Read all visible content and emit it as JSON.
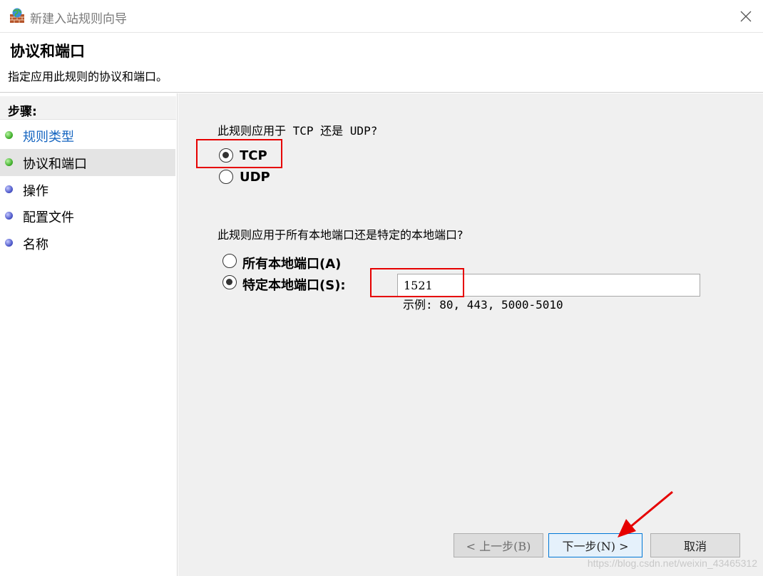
{
  "window": {
    "title": "新建入站规则向导"
  },
  "header": {
    "title": "协议和端口",
    "subtitle": "指定应用此规则的协议和端口。"
  },
  "sidebar": {
    "title": "步骤:",
    "items": [
      {
        "label": "规则类型"
      },
      {
        "label": "协议和端口"
      },
      {
        "label": "操作"
      },
      {
        "label": "配置文件"
      },
      {
        "label": "名称"
      }
    ]
  },
  "protocol": {
    "question": "此规则应用于 TCP 还是 UDP?",
    "options": [
      {
        "label": "TCP",
        "selected": true
      },
      {
        "label": "UDP",
        "selected": false
      }
    ]
  },
  "ports": {
    "question": "此规则应用于所有本地端口还是特定的本地端口?",
    "options": [
      {
        "label": "所有本地端口(A)",
        "selected": false
      },
      {
        "label": "特定本地端口(S):",
        "selected": true
      }
    ],
    "value": "1521",
    "example": "示例: 80, 443, 5000-5010"
  },
  "buttons": {
    "back": "< 上一步(B)",
    "next": "下一步(N) >",
    "cancel": "取消"
  },
  "watermark": "https://blog.csdn.net/weixin_43465312",
  "colors": {
    "annotation": "#e60000",
    "link": "#1565c0",
    "default_button_border": "#0078d7"
  }
}
